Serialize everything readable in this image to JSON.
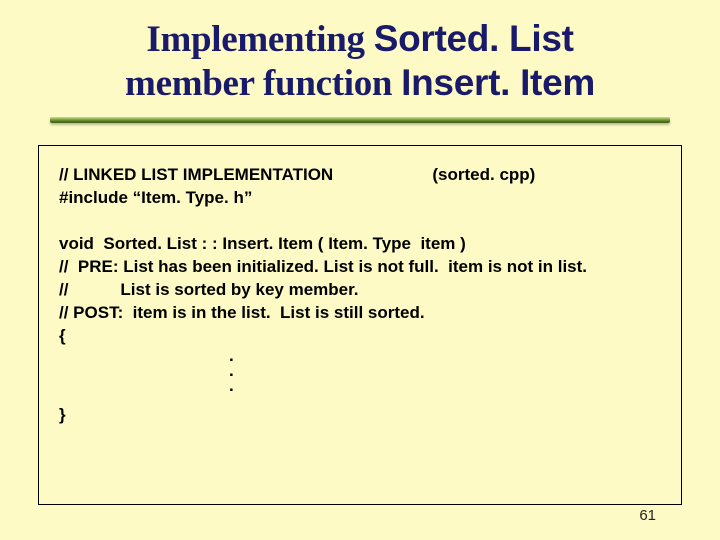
{
  "title": {
    "part1": "Implementing ",
    "part2": "Sorted. List",
    "part3": "member function ",
    "part4": "Insert. Item"
  },
  "code": {
    "l1a": "// LINKED LIST IMPLEMENTATION",
    "l1b": "(sorted. cpp)",
    "l2": "#include “Item. Type. h”",
    "l3": "void  Sorted. List : : Insert. Item ( Item. Type  item )",
    "l4": "//  PRE: List has been initialized. List is not full.  item is not in list.",
    "l5": "//           List is sorted by key member.",
    "l6": "// POST:  item is in the list.  List is still sorted.",
    "l7": "{",
    "dot": ".",
    "l8": "}"
  },
  "page": "61"
}
